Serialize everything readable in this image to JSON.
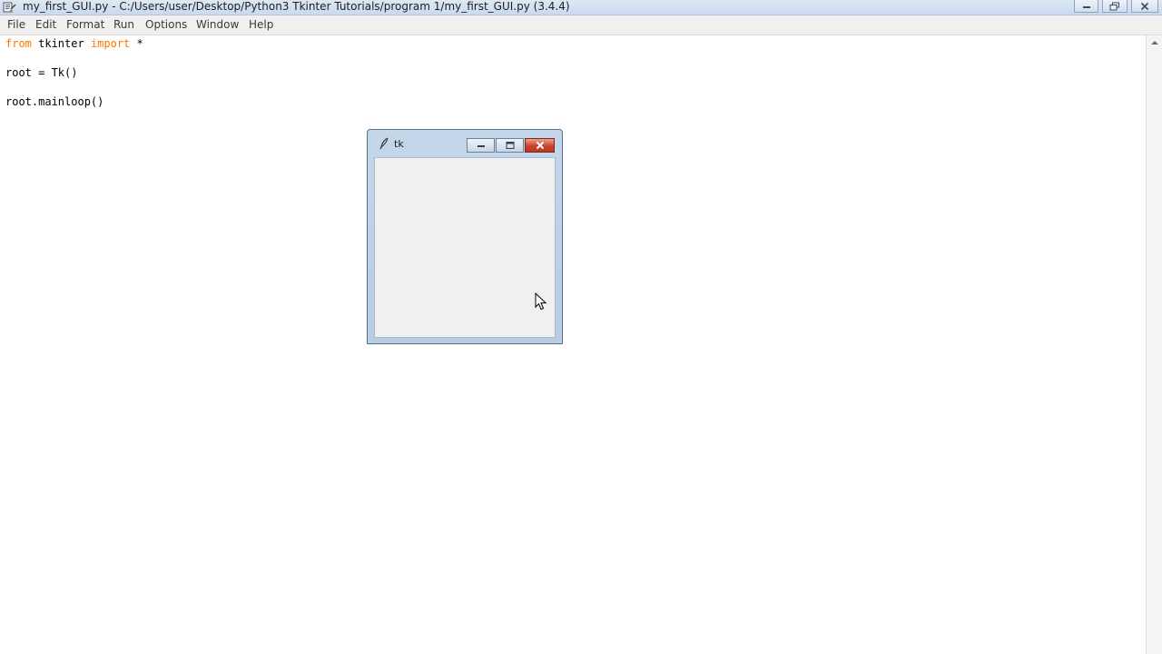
{
  "window": {
    "title": "my_first_GUI.py - C:/Users/user/Desktop/Python3 Tkinter Tutorials/program 1/my_first_GUI.py (3.4.4)"
  },
  "menu": {
    "items": [
      "File",
      "Edit",
      "Format",
      "Run",
      "Options",
      "Window",
      "Help"
    ]
  },
  "editor": {
    "lines": [
      {
        "kw1": "from",
        "mid": " tkinter ",
        "kw2": "import",
        "rest": " *"
      },
      {
        "text": ""
      },
      {
        "text": "root = Tk()"
      },
      {
        "text": ""
      },
      {
        "text": "root.mainloop()"
      }
    ]
  },
  "tk_window": {
    "title": "tk",
    "icon": "feather-icon"
  },
  "colors": {
    "keyword": "#ff7700",
    "close_button": "#c9432b",
    "tk_frame": "#b8cce3"
  }
}
